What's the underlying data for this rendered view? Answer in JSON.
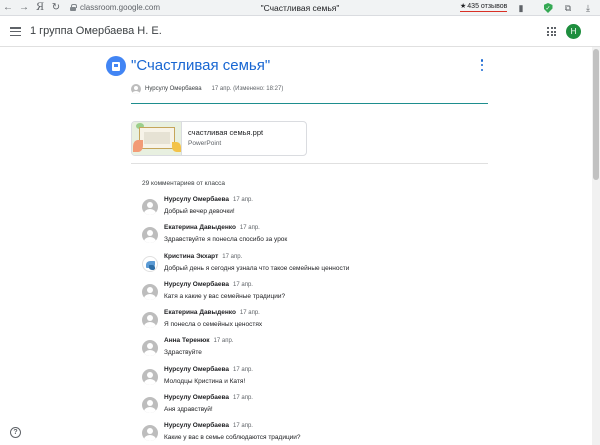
{
  "browser": {
    "back_glyph": "←",
    "forward_glyph": "→",
    "yandex_glyph": "Я",
    "refresh_glyph": "↻",
    "url": "classroom.google.com",
    "tab_title": "\"Счастливая семья\"",
    "reviews_star": "★",
    "reviews": "435 отзывов",
    "bookmark_glyph": "▮",
    "shield_glyph": "✓",
    "extensions_glyph": "⧉",
    "download_glyph": "⤓"
  },
  "header": {
    "class_name": "1 группа Омербаева Н. Е.",
    "account_initial": "Н"
  },
  "post": {
    "title": "\"Счастливая семья\"",
    "author": "Нурсулу Омербаева",
    "date": "17 апр. (Изменено: 18:27)",
    "attachment": {
      "name": "счастливая семья.ppt",
      "type": "PowerPoint"
    }
  },
  "comments_header": "29 комментариев от класса",
  "comments": [
    {
      "author": "Нурсулу Омербаева",
      "date": "17 апр.",
      "text": "Добрый вечер девочки!"
    },
    {
      "author": "Екатерина Давыденко",
      "date": "17 апр.",
      "text": "Здравствуйте я понесла спосибо за урок"
    },
    {
      "author": "Кристина Экхарт",
      "date": "17 апр.",
      "text": "Добрый день я сегодня узнала что такое семейные ценности"
    },
    {
      "author": "Нурсулу Омербаева",
      "date": "17 апр.",
      "text": "Катя а какие у вас семейные традиции?"
    },
    {
      "author": "Екатерина Давыденко",
      "date": "17 апр.",
      "text": "Я понесла о семейных ценостях"
    },
    {
      "author": "Анна Теренюк",
      "date": "17 апр.",
      "text": "Здраствуйте"
    },
    {
      "author": "Нурсулу Омербаева",
      "date": "17 апр.",
      "text": "Молодцы Кристина и Катя!"
    },
    {
      "author": "Нурсулу Омербаева",
      "date": "17 апр.",
      "text": "Аня здравствуй!"
    },
    {
      "author": "Нурсулу Омербаева",
      "date": "17 апр.",
      "text": "Какие у вас в семье соблюдаются традиции?"
    }
  ],
  "help_glyph": "?"
}
